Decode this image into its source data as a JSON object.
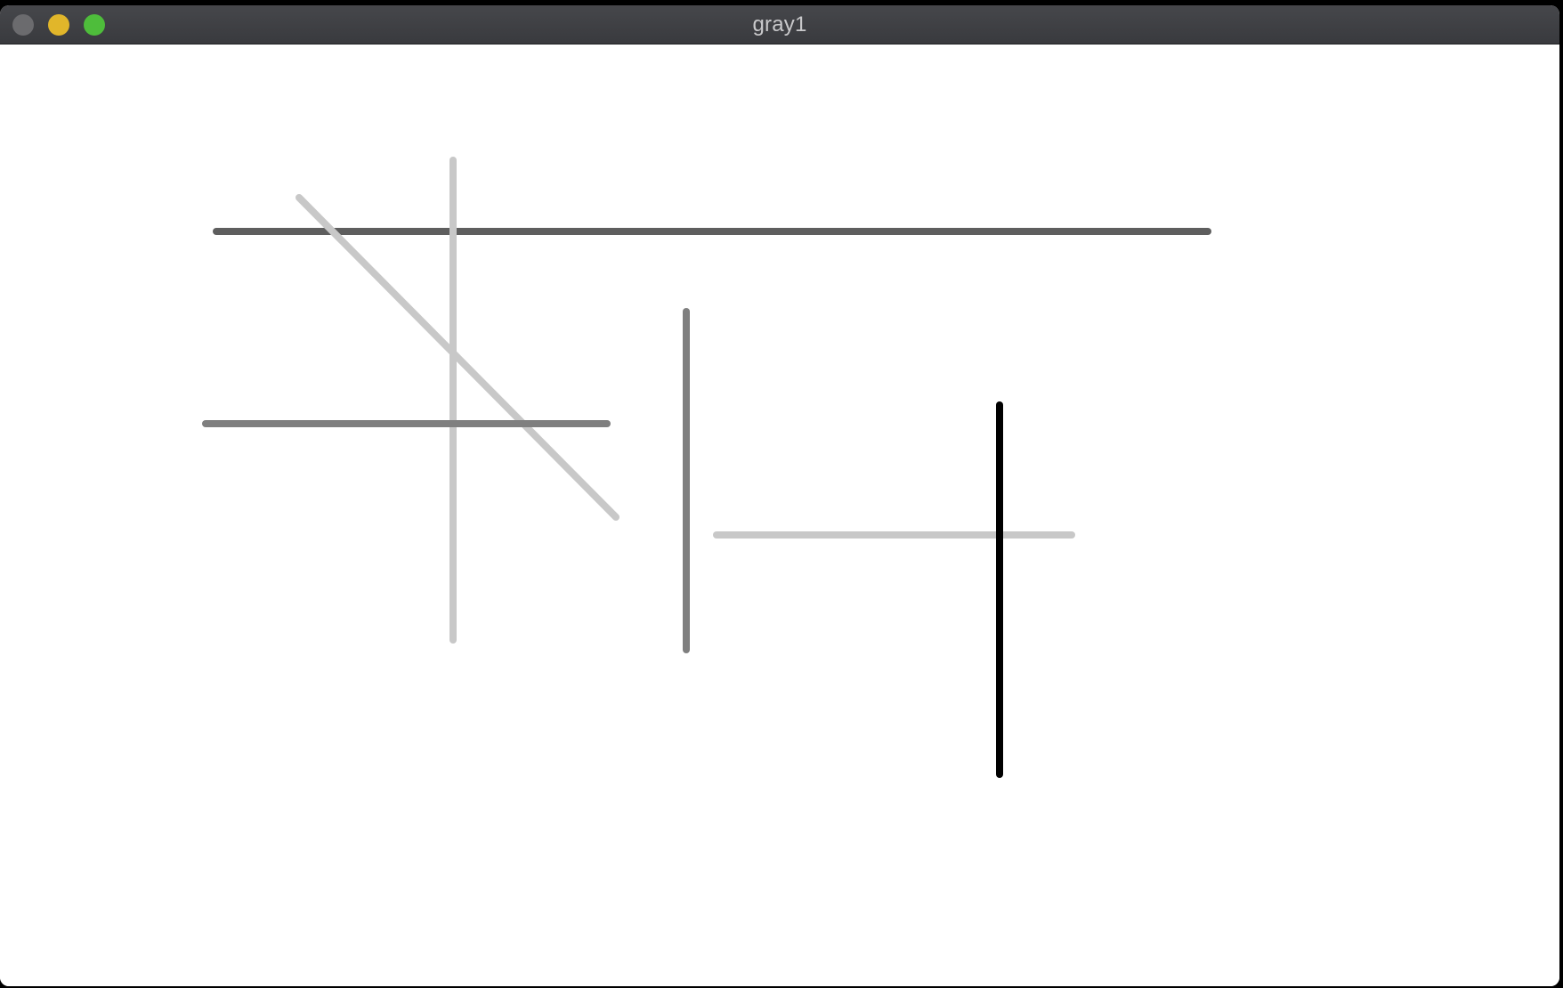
{
  "window": {
    "title": "gray1",
    "controls": {
      "close_color": "#6b6b6e",
      "minimize_color": "#e1b62a",
      "maximize_color": "#4ebd3b"
    }
  },
  "canvas": {
    "background": "#ffffff",
    "line_colors": {
      "dark_gray": "#5e5e5e",
      "medium_gray": "#7f7f7f",
      "light_gray": "#c8c8c8",
      "black": "#000000"
    }
  }
}
